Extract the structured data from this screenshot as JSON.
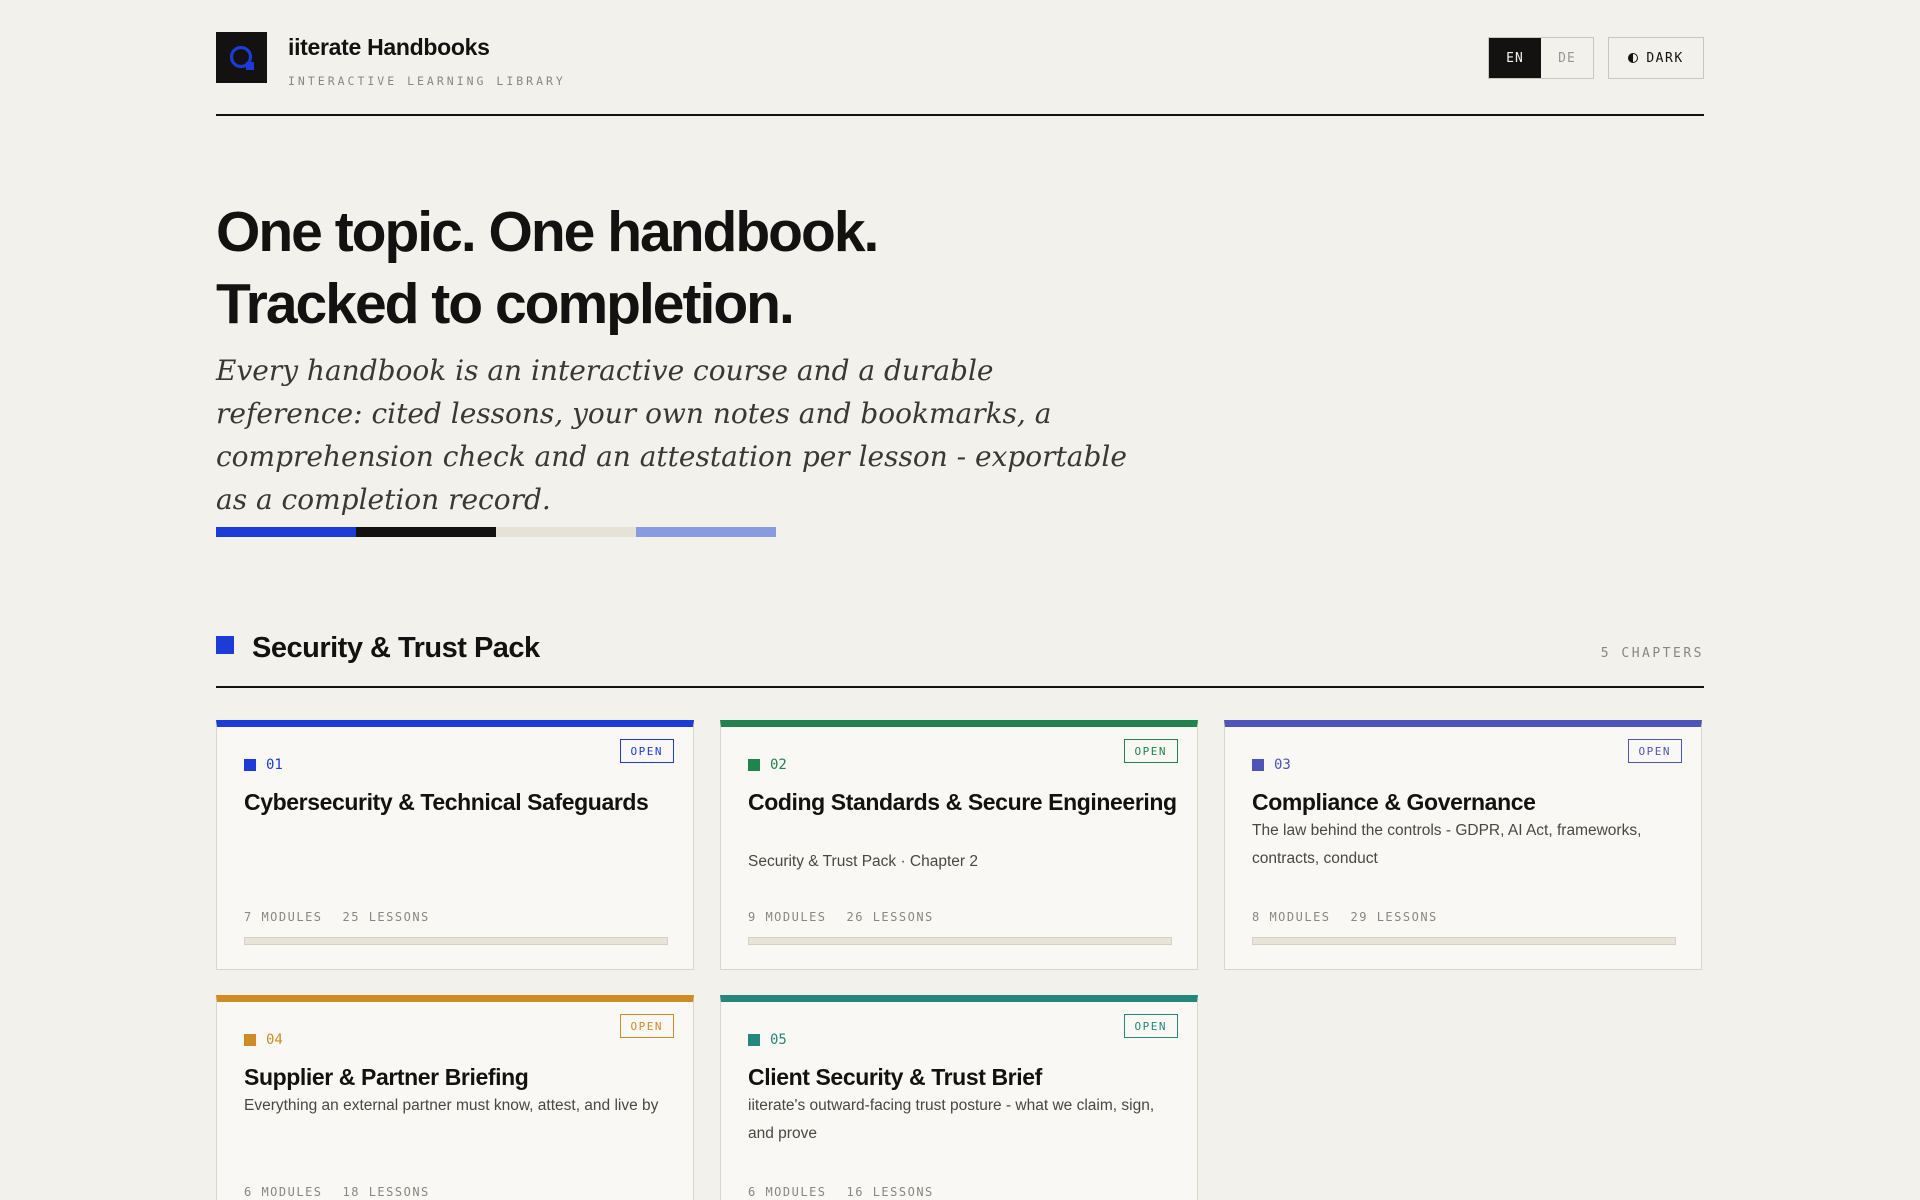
{
  "header": {
    "brand_title": "iiterate Handbooks",
    "brand_subtitle": "INTERACTIVE LEARNING LIBRARY",
    "lang_en": "EN",
    "lang_de": "DE",
    "dark_label": "DARK"
  },
  "hero": {
    "title_line1": "One topic. One handbook.",
    "title_line2": "Tracked to completion.",
    "subtitle": "Every handbook is an interactive course and a durable reference: cited lessons, your own notes and bookmarks, a comprehension check and an attestation per lesson - exportable as a completion record."
  },
  "accent_bar_colors": [
    "#1d3bd6",
    "#141210",
    "#e6e2d8",
    "#8a9ae0"
  ],
  "section": {
    "title": "Security & Trust Pack",
    "count": "5 CHAPTERS",
    "color": "#1d3bd6"
  },
  "cards": [
    {
      "number": "01",
      "title": "Cybersecurity & Technical Safeguards",
      "description": "",
      "badge": "OPEN",
      "modules": "7 MODULES",
      "lessons": "25 LESSONS",
      "color": "#1d3bd6",
      "progress": 0
    },
    {
      "number": "02",
      "title": "Coding Standards & Secure Engineering",
      "description": "Security & Trust Pack · Chapter 2",
      "badge": "OPEN",
      "modules": "9 MODULES",
      "lessons": "26 LESSONS",
      "color": "#23834f",
      "progress": 0
    },
    {
      "number": "03",
      "title": "Compliance & Governance",
      "description": "The law behind the controls - GDPR, AI Act, frameworks, contracts, conduct",
      "badge": "OPEN",
      "modules": "8 MODULES",
      "lessons": "29 LESSONS",
      "color": "#4f55b8",
      "progress": 0
    },
    {
      "number": "04",
      "title": "Supplier & Partner Briefing",
      "description": "Everything an external partner must know, attest, and live by",
      "badge": "OPEN",
      "modules": "6 MODULES",
      "lessons": "18 LESSONS",
      "color": "#cf8c25",
      "progress": 0
    },
    {
      "number": "05",
      "title": "Client Security & Trust Brief",
      "description": "iiterate's outward-facing trust posture - what we claim, sign, and prove",
      "badge": "OPEN",
      "modules": "6 MODULES",
      "lessons": "16 LESSONS",
      "color": "#25877b",
      "progress": 0
    }
  ]
}
